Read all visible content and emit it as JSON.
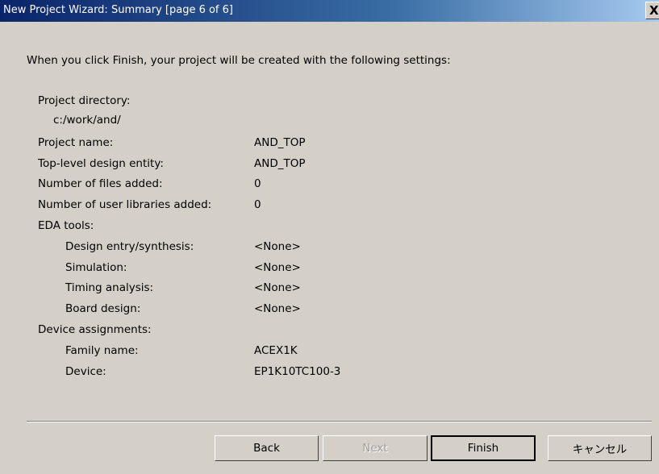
{
  "window": {
    "title": "New Project Wizard: Summary [page 6 of 6]",
    "close_label": "X"
  },
  "intro": "When you click Finish, your project will be created with the following settings:",
  "settings": [
    {
      "label": "Project directory:",
      "value": ""
    },
    {
      "label": "c:/work/and/",
      "value": ""
    },
    {
      "label": "Project name:",
      "value": "AND_TOP"
    },
    {
      "label": "Top-level design entity:",
      "value": "AND_TOP"
    },
    {
      "label": "Number of files added:",
      "value": "0"
    },
    {
      "label": "Number of user libraries added:",
      "value": "0"
    },
    {
      "label": "EDA tools:",
      "value": ""
    },
    {
      "label": "Design entry/synthesis:",
      "value": "<None>"
    },
    {
      "label": "Simulation:",
      "value": "<None>"
    },
    {
      "label": "Timing analysis:",
      "value": "<None>"
    },
    {
      "label": "Board design:",
      "value": "<None>"
    },
    {
      "label": "Device assignments:",
      "value": ""
    },
    {
      "label": "Family name:",
      "value": "ACEX1K"
    },
    {
      "label": "Device:",
      "value": "EP1K10TC100-3"
    }
  ],
  "buttons": {
    "back": "Back",
    "next": "Next",
    "finish": "Finish",
    "cancel": "キャンセル"
  }
}
